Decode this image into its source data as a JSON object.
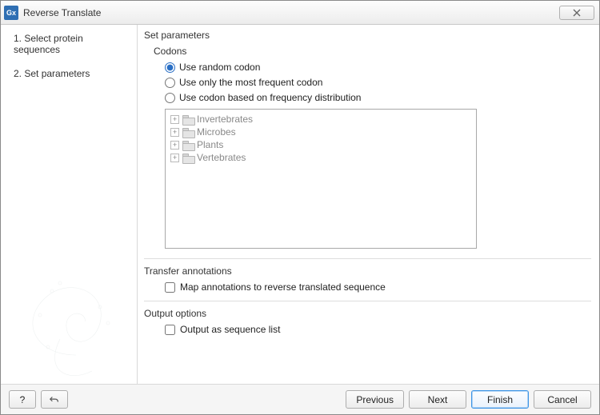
{
  "window": {
    "app_icon_text": "Gx",
    "title": "Reverse Translate"
  },
  "sidebar": {
    "steps": [
      {
        "num": "1.",
        "label": "Select protein sequences"
      },
      {
        "num": "2.",
        "label": "Set parameters"
      }
    ]
  },
  "main": {
    "section_title": "Set parameters",
    "codons": {
      "label": "Codons",
      "options": {
        "random": "Use random codon",
        "frequent": "Use only the most frequent codon",
        "distribution": "Use codon based on frequency distribution"
      },
      "selected": "random",
      "tree": [
        "Invertebrates",
        "Microbes",
        "Plants",
        "Vertebrates"
      ]
    },
    "transfer": {
      "label": "Transfer annotations",
      "checkbox_label": "Map annotations to reverse translated sequence",
      "checked": false
    },
    "output": {
      "label": "Output options",
      "checkbox_label": "Output as sequence list",
      "checked": false
    }
  },
  "footer": {
    "help": "?",
    "previous": "Previous",
    "next": "Next",
    "finish": "Finish",
    "cancel": "Cancel"
  }
}
